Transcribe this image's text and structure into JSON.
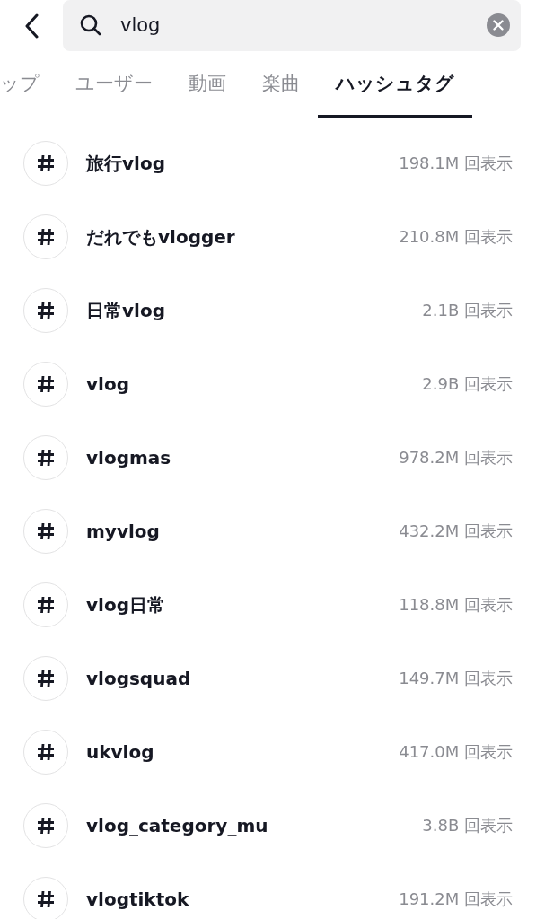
{
  "search": {
    "value": "vlog"
  },
  "tabs": [
    {
      "label": "ップ",
      "selected": false
    },
    {
      "label": "ユーザー",
      "selected": false
    },
    {
      "label": "動画",
      "selected": false
    },
    {
      "label": "楽曲",
      "selected": false
    },
    {
      "label": "ハッシュタグ",
      "selected": true
    }
  ],
  "hashtags": [
    {
      "name": "旅行vlog",
      "views": "198.1M 回表示"
    },
    {
      "name": "だれでもvlogger",
      "views": "210.8M 回表示"
    },
    {
      "name": "日常vlog",
      "views": "2.1B 回表示"
    },
    {
      "name": "vlog",
      "views": "2.9B 回表示"
    },
    {
      "name": "vlogmas",
      "views": "978.2M 回表示"
    },
    {
      "name": "myvlog",
      "views": "432.2M 回表示"
    },
    {
      "name": "vlog日常",
      "views": "118.8M 回表示"
    },
    {
      "name": "vlogsquad",
      "views": "149.7M 回表示"
    },
    {
      "name": "ukvlog",
      "views": "417.0M 回表示"
    },
    {
      "name": "vlog_category_mu",
      "views": "3.8B 回表示"
    },
    {
      "name": "vlogtiktok",
      "views": "191.2M 回表示"
    }
  ]
}
